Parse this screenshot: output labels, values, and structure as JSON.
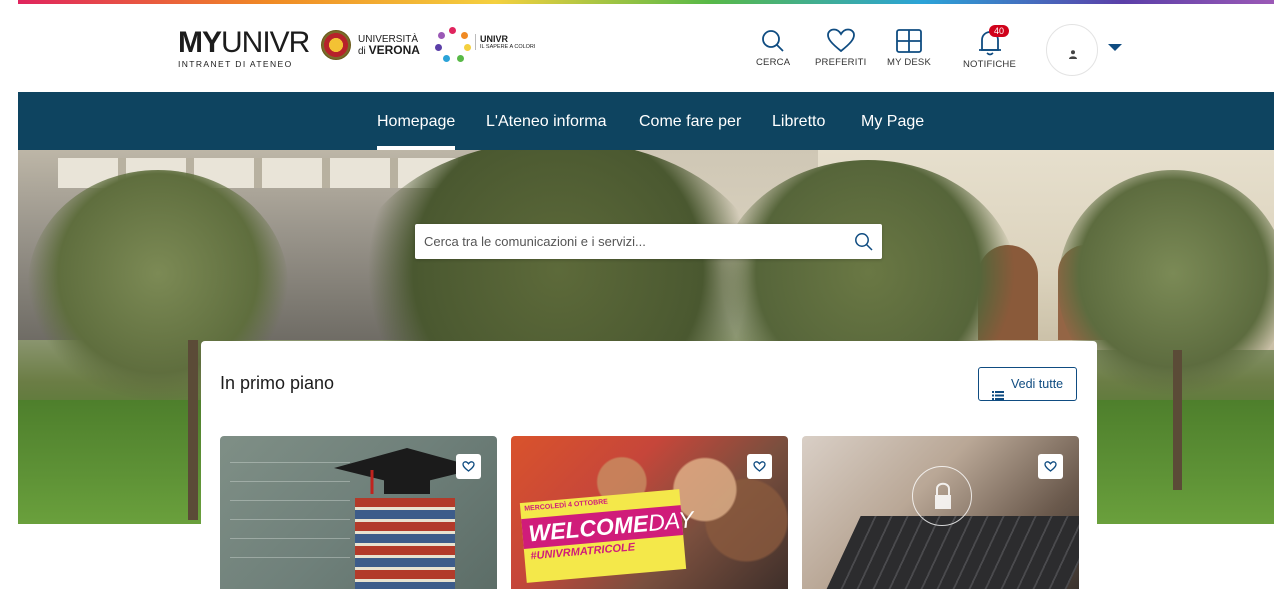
{
  "brand": {
    "logo_my": "MY",
    "logo_univr": "UNIVR",
    "logo_subtitle": "INTRANET DI ATENEO",
    "university_line1": "UNIVERSITÀ",
    "university_line2_prefix": "di",
    "university_line2": "VERONA",
    "univr_title_prefix": "UNI",
    "univr_title": "VR",
    "univr_tagline": "IL SAPERE A COLORI"
  },
  "toolbar": {
    "search_label": "CERCA",
    "favorites_label": "PREFERITI",
    "desk_label": "MY DESK",
    "notifications_label": "NOTIFICHE",
    "notifications_count": "40"
  },
  "nav": {
    "items": [
      {
        "label": "Homepage",
        "active": true
      },
      {
        "label": "L'Ateneo informa",
        "active": false
      },
      {
        "label": "Come fare per",
        "active": false
      },
      {
        "label": "Libretto",
        "active": false
      },
      {
        "label": "My Page",
        "active": false
      }
    ]
  },
  "hero": {
    "search_placeholder": "Cerca tra le comunicazioni e i servizi..."
  },
  "featured": {
    "title": "In primo piano",
    "see_all_label": "Vedi tutte",
    "cards": [
      {
        "image": "graduation-cap-on-books"
      },
      {
        "image": "welcome-day-poster",
        "poster_day_prefix": "MERCOLEDÌ",
        "poster_date": "4 OTTOBRE",
        "poster_welcome": "WELCOME",
        "poster_day": "DAY",
        "poster_hashtag": "#UNIVRMATRICOLE"
      },
      {
        "image": "hands-on-laptop-security"
      }
    ]
  },
  "colors": {
    "nav_bg": "#0e4460",
    "accent": "#0f4c81",
    "badge": "#d0021b"
  }
}
